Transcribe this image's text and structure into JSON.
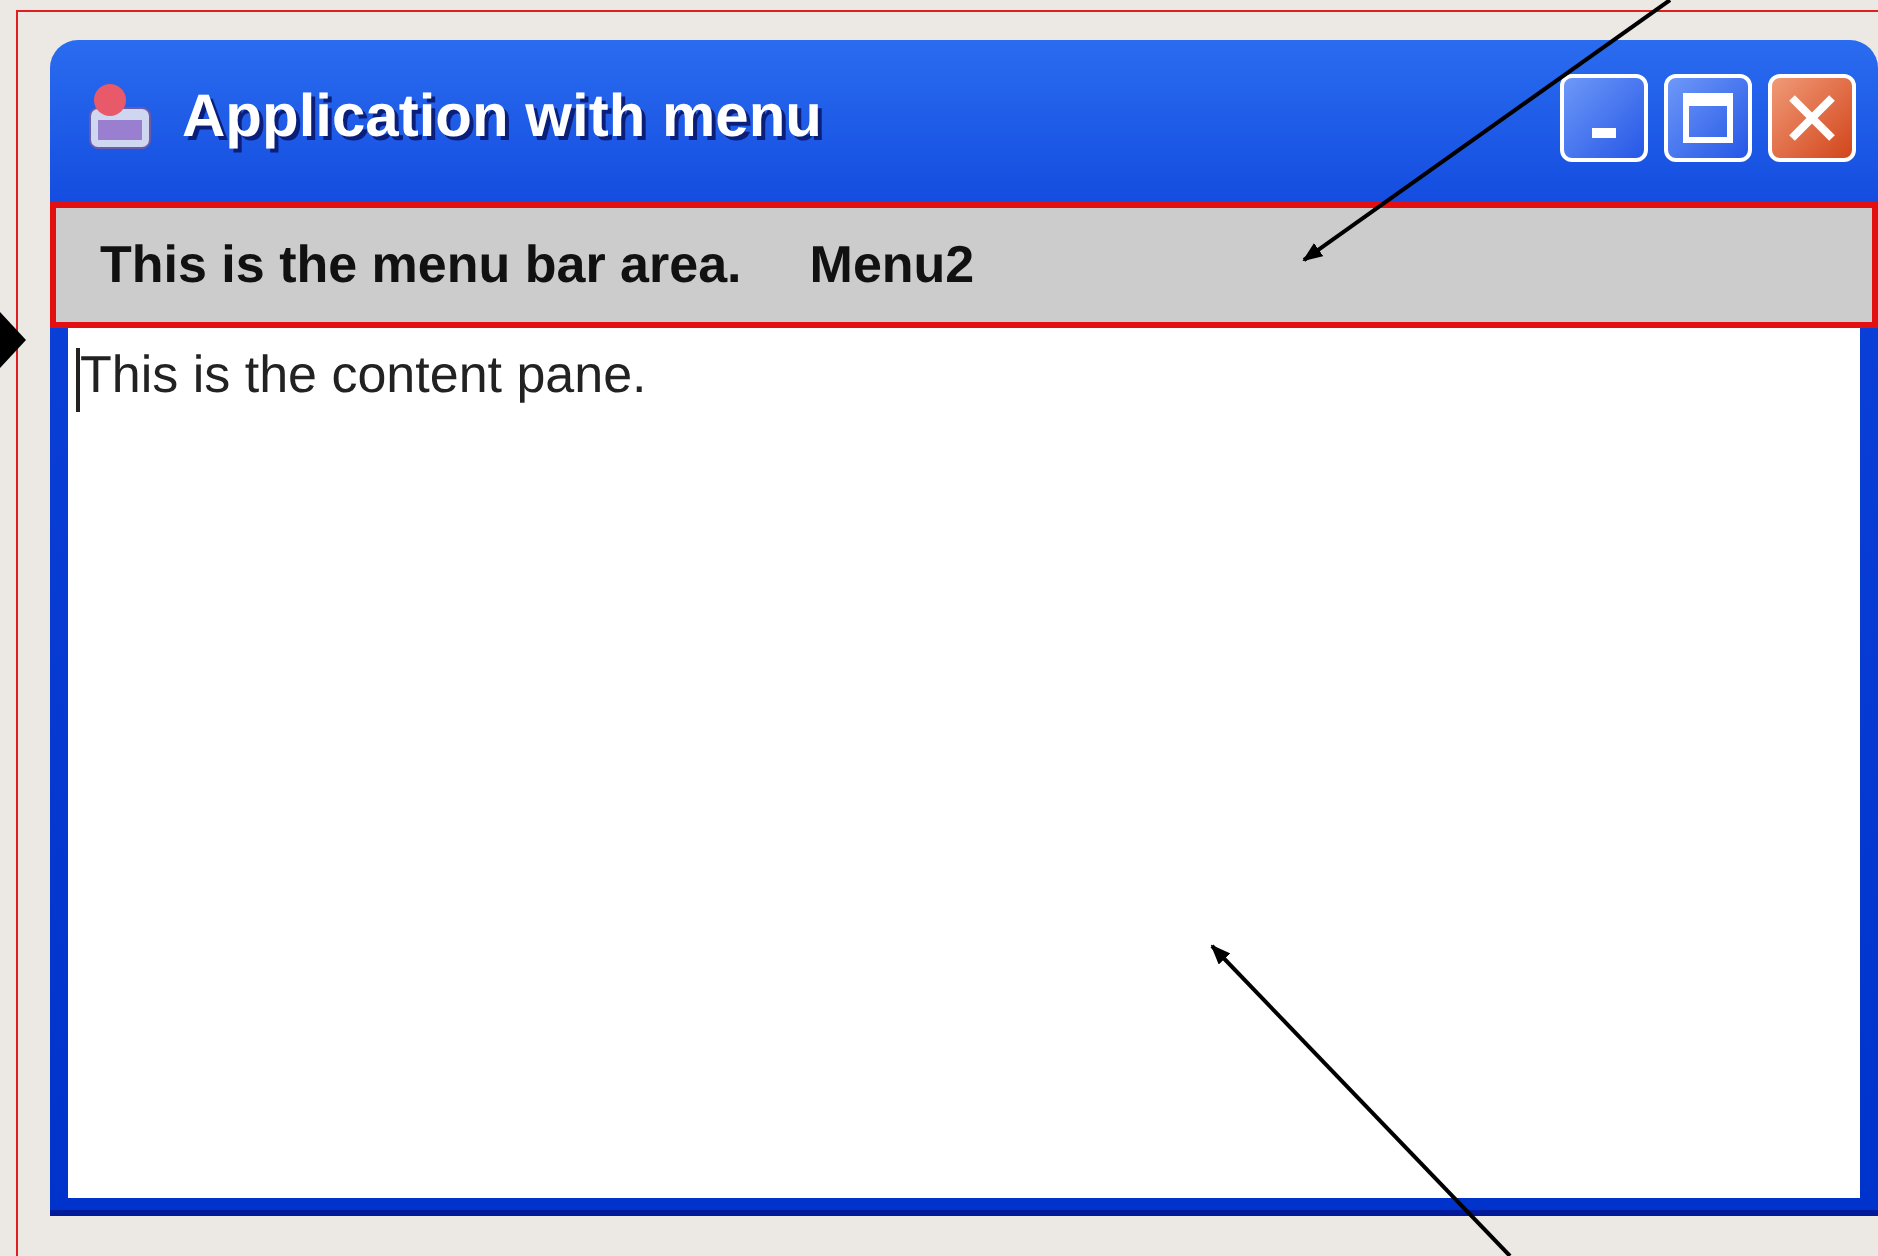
{
  "window": {
    "title": "Application with menu"
  },
  "menu_bar": {
    "items": [
      "This is the menu bar area.",
      "Menu2"
    ]
  },
  "content_pane": {
    "text": "This is the content pane."
  }
}
